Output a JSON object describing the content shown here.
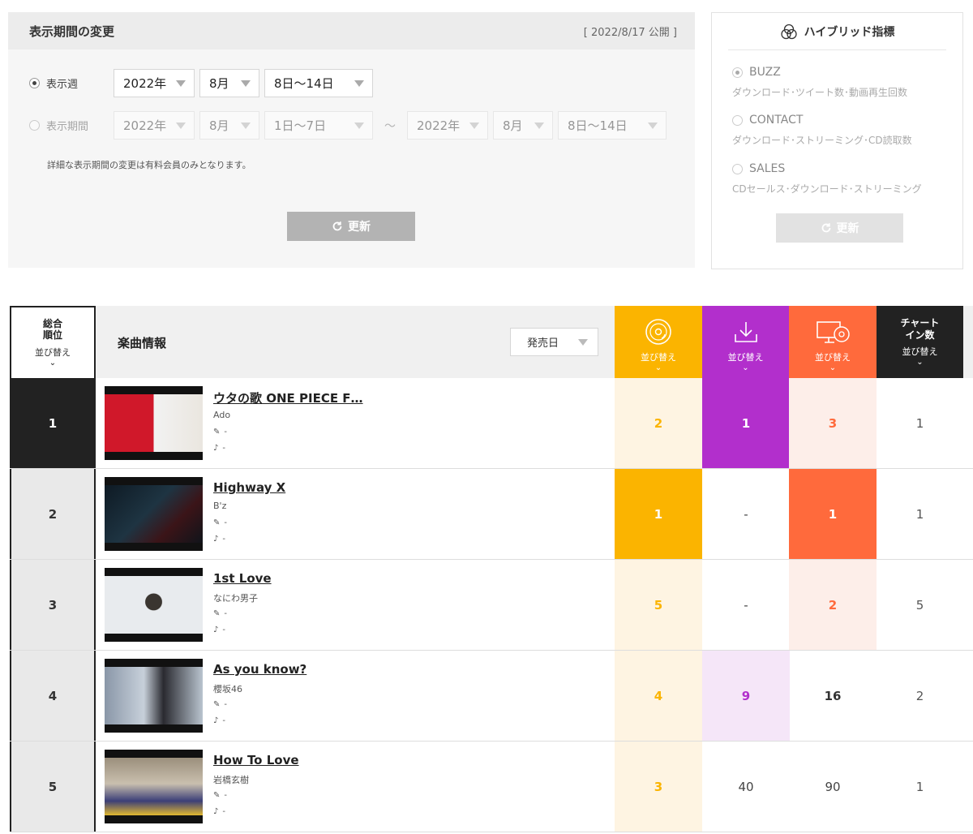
{
  "period": {
    "title": "表示期間の変更",
    "published": "[ 2022/8/17 公開 ]",
    "week_label": "表示週",
    "week_year": "2022年",
    "week_month": "8月",
    "week_days": "8日〜14日",
    "range_label": "表示期間",
    "range_from_year": "2022年",
    "range_from_month": "8月",
    "range_from_days": "1日〜7日",
    "range_sep": "〜",
    "range_to_year": "2022年",
    "range_to_month": "8月",
    "range_to_days": "8日〜14日",
    "note": "詳細な表示期間の変更は有料会員のみとなります。",
    "refresh": "更新"
  },
  "hybrid": {
    "title": "ハイブリッド指標",
    "options": [
      {
        "label": "BUZZ",
        "desc": "ダウンロード･ツイート数･動画再生回数"
      },
      {
        "label": "CONTACT",
        "desc": "ダウンロード･ストリーミング･CD読取数"
      },
      {
        "label": "SALES",
        "desc": "CDセールス･ダウンロード･ストリーミング"
      }
    ],
    "refresh": "更新"
  },
  "table": {
    "rank_header": "総合\n順位",
    "sort_label": "並び替え",
    "info_header": "楽曲情報",
    "release_sort": "発売日",
    "chart_in_header": "チャート\nイン数",
    "colors": {
      "buzz": "#fbb400",
      "download": "#b22fcc",
      "streaming": "#ff6a3c",
      "chart_in": "#222222"
    },
    "rows": [
      {
        "rank": "1",
        "title": "ウタの歌 ONE PIECE F…",
        "artist": "Ado",
        "lyricist": "-",
        "composer": "-",
        "buzz": "2",
        "download": "1",
        "streaming": "3",
        "chart_in": "1"
      },
      {
        "rank": "2",
        "title": "Highway X",
        "artist": "B'z",
        "lyricist": "-",
        "composer": "-",
        "buzz": "1",
        "download": "-",
        "streaming": "1",
        "chart_in": "1"
      },
      {
        "rank": "3",
        "title": "1st Love",
        "artist": "なにわ男子",
        "lyricist": "-",
        "composer": "-",
        "buzz": "5",
        "download": "-",
        "streaming": "2",
        "chart_in": "5"
      },
      {
        "rank": "4",
        "title": "As you know?",
        "artist": "櫻坂46",
        "lyricist": "-",
        "composer": "-",
        "buzz": "4",
        "download": "9",
        "streaming": "16",
        "chart_in": "2"
      },
      {
        "rank": "5",
        "title": "How To Love",
        "artist": "岩橋玄樹",
        "lyricist": "-",
        "composer": "-",
        "buzz": "3",
        "download": "40",
        "streaming": "90",
        "chart_in": "1"
      }
    ]
  }
}
